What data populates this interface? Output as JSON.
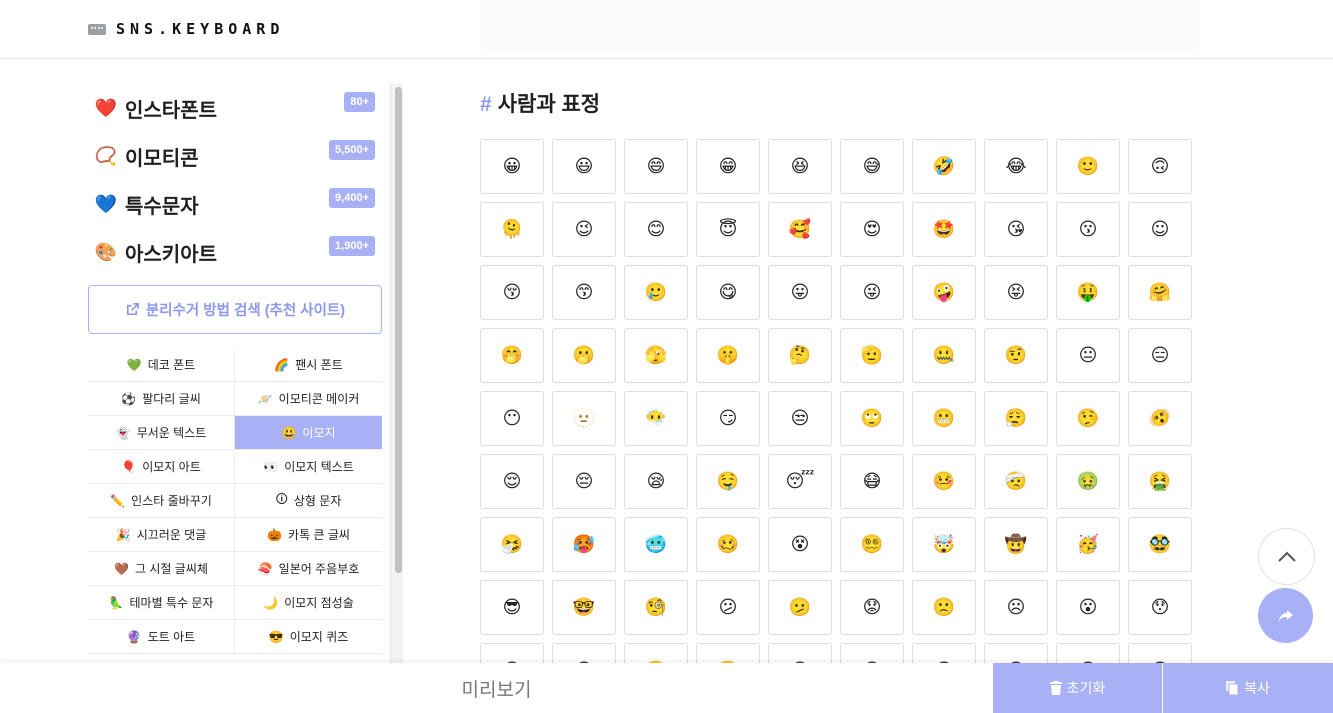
{
  "header": {
    "logo_text": "SNS.KEYBOARD",
    "logo_icon": "keyboard-icon"
  },
  "sidebar": {
    "categories": [
      {
        "icon": "❤️",
        "label": "인스타폰트",
        "badge": "80+"
      },
      {
        "icon": "📿",
        "label": "이모티콘",
        "badge": "5,500+"
      },
      {
        "icon": "💙",
        "label": "특수문자",
        "badge": "9,400+"
      },
      {
        "icon": "🎨",
        "label": "아스키아트",
        "badge": "1,900+"
      }
    ],
    "outline_button": {
      "icon": "external-link-icon",
      "label": "분리수거 방법 검색 (추천 사이트)"
    },
    "menu": [
      {
        "emoji": "💚",
        "label": "데코 폰트"
      },
      {
        "emoji": "🌈",
        "label": "팬시 폰트"
      },
      {
        "emoji": "⚽",
        "label": "팔다리 글씨"
      },
      {
        "emoji": "🪐",
        "label": "이모티콘 메이커"
      },
      {
        "emoji": "👻",
        "label": "무서운 텍스트"
      },
      {
        "emoji": "😃",
        "label": "이모지",
        "active": true
      },
      {
        "emoji": "🎈",
        "label": "이모지 아트"
      },
      {
        "emoji": "👀",
        "label": "이모지 텍스트"
      },
      {
        "emoji": "✏️",
        "label": "인스타 줄바꾸기"
      },
      {
        "emoji": "🛈",
        "label": "상형 문자"
      },
      {
        "emoji": "🎉",
        "label": "시끄러운 댓글"
      },
      {
        "emoji": "🎃",
        "label": "카톡 큰 글씨"
      },
      {
        "emoji": "🤎",
        "label": "그 시절 글씨체"
      },
      {
        "emoji": "🍣",
        "label": "일본어 주음부호"
      },
      {
        "emoji": "🦜",
        "label": "테마별 특수 문자"
      },
      {
        "emoji": "🌙",
        "label": "이모지 점성술"
      },
      {
        "emoji": "🔮",
        "label": "도트 아트"
      },
      {
        "emoji": "😎",
        "label": "이모지 퀴즈"
      }
    ]
  },
  "main": {
    "section_hash": "#",
    "section_title": "사람과 표정",
    "emojis": [
      "😀",
      "😃",
      "😄",
      "😁",
      "😆",
      "😅",
      "🤣",
      "😂",
      "🙂",
      "🙃",
      "🫠",
      "😉",
      "😊",
      "😇",
      "🥰",
      "😍",
      "🤩",
      "😘",
      "😗",
      "☺",
      "😚",
      "😙",
      "🥲",
      "😋",
      "😛",
      "😜",
      "🤪",
      "😝",
      "🤑",
      "🤗",
      "🤭",
      "🫢",
      "🫣",
      "🤫",
      "🤔",
      "🫡",
      "🤐",
      "🤨",
      "😐",
      "😑",
      "😶",
      "🫥",
      "😶‍🌫️",
      "😏",
      "😒",
      "🙄",
      "😬",
      "😮‍💨",
      "🤥",
      "🫨",
      "😌",
      "😔",
      "😪",
      "🤤",
      "😴",
      "😷",
      "🤒",
      "🤕",
      "🤢",
      "🤮",
      "🤧",
      "🥵",
      "🥶",
      "🥴",
      "😵",
      "😵‍💫",
      "🤯",
      "🤠",
      "🥳",
      "🥸",
      "😎",
      "🤓",
      "🧐",
      "😕",
      "🫤",
      "😟",
      "🙁",
      "☹",
      "😮",
      "😯",
      "😲",
      "😳",
      "🥺",
      "🥹",
      "😦",
      "😧",
      "😨",
      "😰",
      "😥",
      "😢"
    ]
  },
  "floating": {
    "up_icon": "chevron-up-icon",
    "share_icon": "share-icon"
  },
  "bottom": {
    "preview_label": "미리보기",
    "reset_label": "초기화",
    "copy_label": "복사"
  },
  "colors": {
    "accent": "#a8b1f5",
    "accent_text": "#8d97ef"
  }
}
